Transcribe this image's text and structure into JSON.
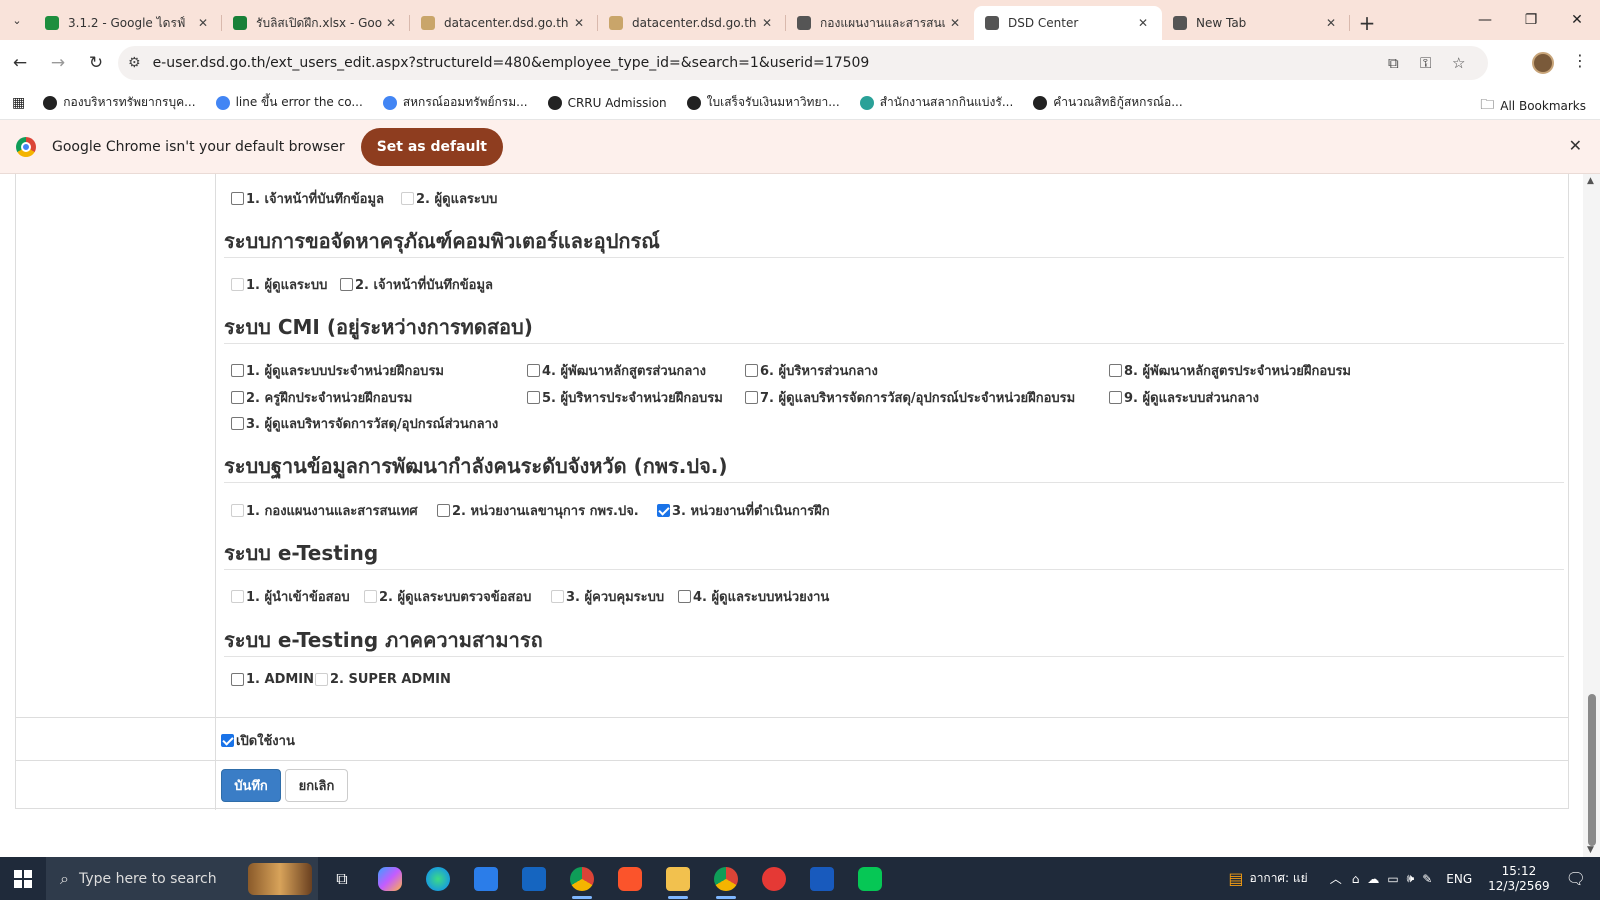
{
  "browser": {
    "tabs": [
      {
        "title": "3.1.2 - Google ไดรฟ์",
        "icon": "google-drive-icon",
        "color": "#1e8e3e"
      },
      {
        "title": "รับลิสเปิดฝึก.xlsx - Goog",
        "icon": "google-sheets-icon",
        "color": "#188038"
      },
      {
        "title": "datacenter.dsd.go.th |",
        "icon": "dsd-site-icon",
        "color": "#c9a56a"
      },
      {
        "title": "datacenter.dsd.go.th |",
        "icon": "dsd-site-icon",
        "color": "#c9a56a"
      },
      {
        "title": "กองแผนงานและสารสนเท",
        "icon": "globe-icon",
        "color": "#555555"
      },
      {
        "title": "DSD Center",
        "icon": "globe-icon",
        "color": "#555555",
        "active": true
      },
      {
        "title": "New Tab",
        "icon": "chrome-icon",
        "color": "#555555"
      }
    ],
    "url": "e-user.dsd.go.th/ext_users_edit.aspx?structureId=480&employee_type_id=&search=1&userid=17509",
    "bookmarks": [
      {
        "label": "กองบริหารทรัพยากรบุค...",
        "color": "#222222"
      },
      {
        "label": "line ขึ้น error the co...",
        "color": "#4285f4"
      },
      {
        "label": "สหกรณ์ออมทรัพย์กรม...",
        "color": "#4285f4"
      },
      {
        "label": "CRRU Admission",
        "color": "#222222"
      },
      {
        "label": "ใบเสร็จรับเงินมหาวิทยา...",
        "color": "#222222"
      },
      {
        "label": "สำนักงานสลากกินแบ่งรั...",
        "color": "#2aa198"
      },
      {
        "label": "คำนวณสิทธิกู้สหกรณ์อ...",
        "color": "#222222"
      }
    ],
    "all_bookmarks": "All Bookmarks",
    "infobar": {
      "message": "Google Chrome isn't your default browser",
      "button": "Set as default"
    }
  },
  "form": {
    "sections": [
      {
        "title": "",
        "options": [
          {
            "label": "1. เจ้าหน้าที่บันทึกข้อมูล",
            "checked": false,
            "disabled": false
          },
          {
            "label": "2. ผู้ดูแลระบบ",
            "checked": false,
            "disabled": true
          }
        ]
      },
      {
        "title": "ระบบการขอจัดหาครุภัณฑ์คอมพิวเตอร์และอุปกรณ์",
        "options": [
          {
            "label": "1. ผู้ดูแลระบบ",
            "checked": false,
            "disabled": true
          },
          {
            "label": "2. เจ้าหน้าที่บันทึกข้อมูล",
            "checked": false,
            "disabled": false
          }
        ]
      },
      {
        "title": "ระบบ CMI (อยู่ระหว่างการทดสอบ)",
        "options": [
          {
            "label": "1. ผู้ดูแลระบบประจำหน่วยฝึกอบรม",
            "checked": false,
            "disabled": false
          },
          {
            "label": "4. ผู้พัฒนาหลักสูตรส่วนกลาง",
            "checked": false,
            "disabled": false
          },
          {
            "label": "6. ผู้บริหารส่วนกลาง",
            "checked": false,
            "disabled": false
          },
          {
            "label": "8. ผู้พัฒนาหลักสูตรประจำหน่วยฝึกอบรม",
            "checked": false,
            "disabled": false
          },
          {
            "label": "2. ครูฝึกประจำหน่วยฝึกอบรม",
            "checked": false,
            "disabled": false
          },
          {
            "label": "5. ผู้บริหารประจำหน่วยฝึกอบรม",
            "checked": false,
            "disabled": false
          },
          {
            "label": "7. ผู้ดูแลบริหารจัดการวัสดุ/อุปกรณ์ประจำหน่วยฝึกอบรม",
            "checked": false,
            "disabled": false
          },
          {
            "label": "9. ผู้ดูแลระบบส่วนกลาง",
            "checked": false,
            "disabled": false
          },
          {
            "label": "3. ผู้ดูแลบริหารจัดการวัสดุ/อุปกรณ์ส่วนกลาง",
            "checked": false,
            "disabled": false
          }
        ]
      },
      {
        "title": "ระบบฐานข้อมูลการพัฒนากำลังคนระดับจังหวัด (กพร.ปจ.)",
        "options": [
          {
            "label": "1. กองแผนงานและสารสนเทศ",
            "checked": false,
            "disabled": true
          },
          {
            "label": "2. หน่วยงานเลขานุการ กพร.ปจ.",
            "checked": false,
            "disabled": false
          },
          {
            "label": "3. หน่วยงานที่ดำเนินการฝึก",
            "checked": true,
            "disabled": false
          }
        ]
      },
      {
        "title": "ระบบ e-Testing",
        "options": [
          {
            "label": "1. ผู้นำเข้าข้อสอบ",
            "checked": false,
            "disabled": true
          },
          {
            "label": "2. ผู้ดูแลระบบตรวจข้อสอบ",
            "checked": false,
            "disabled": true
          },
          {
            "label": "3. ผู้ควบคุมระบบ",
            "checked": false,
            "disabled": true
          },
          {
            "label": "4. ผู้ดูแลระบบหน่วยงาน",
            "checked": false,
            "disabled": false
          }
        ]
      },
      {
        "title": "ระบบ e-Testing ภาคความสามารถ",
        "options": [
          {
            "label": "1. ADMIN",
            "checked": false,
            "disabled": false
          },
          {
            "label": "2. SUPER ADMIN",
            "checked": false,
            "disabled": true
          }
        ]
      }
    ],
    "enabled": {
      "label": "เปิดใช้งาน",
      "checked": true
    },
    "save_label": "บันทึก",
    "cancel_label": "ยกเลิก"
  },
  "taskbar": {
    "search_placeholder": "Type here to search",
    "weather": "อากาศ: แย่",
    "language": "ENG",
    "time": "15:12",
    "date": "12/3/2569"
  },
  "colors": {
    "accent": "#3a7dc6",
    "tabbar": "#f9e3da",
    "infobar_button": "#8e3d1f"
  }
}
